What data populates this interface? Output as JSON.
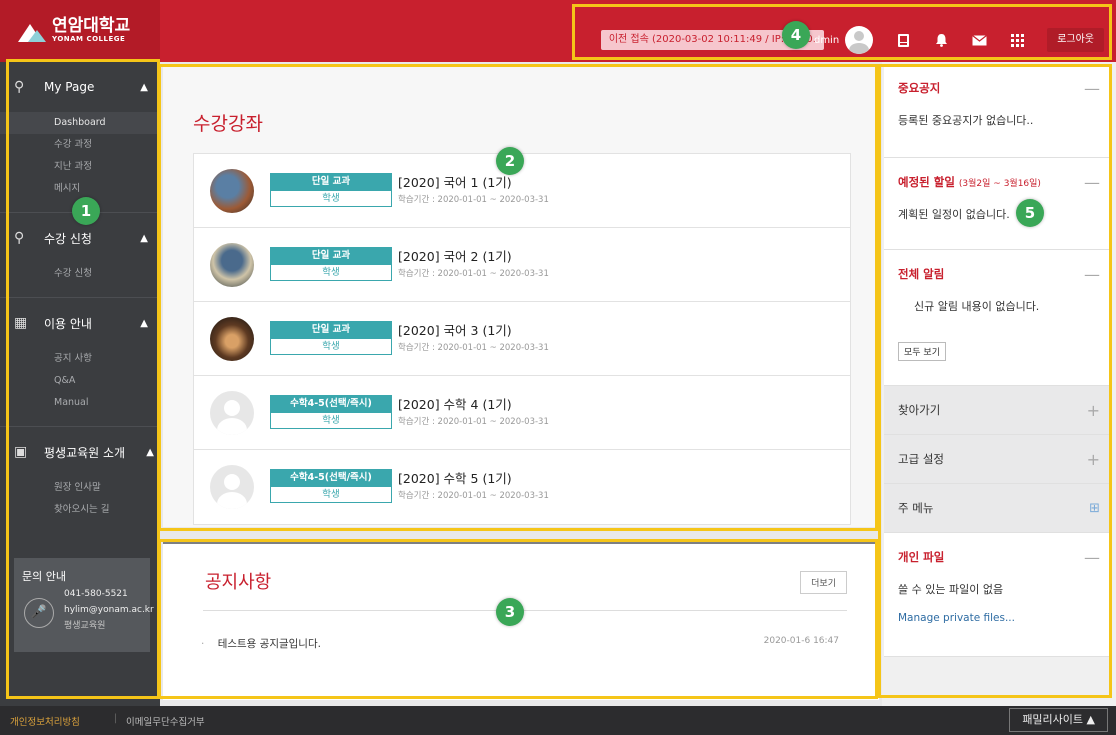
{
  "header": {
    "logo_ko": "연암대학교",
    "logo_en": "YONAM COLLEGE",
    "prev_login": "이전 접속 (2020-03-02 10:11:49 / IP:127.0.",
    "user_name": "dmin",
    "logout": "로그아웃",
    "icons": [
      "tablet-icon",
      "bell-icon",
      "mail-icon",
      "grid-icon"
    ]
  },
  "sidebar": {
    "sections": [
      {
        "title": "My Page",
        "icon": "user-icon",
        "items": [
          "Dashboard",
          "수강 과정",
          "지난 과정",
          "메시지"
        ]
      },
      {
        "title": "수강 신청",
        "icon": "user-icon",
        "items": [
          "수강 신청"
        ]
      },
      {
        "title": "이용 안내",
        "icon": "map-icon",
        "items": [
          "공지 사항",
          "Q&A",
          "Manual"
        ]
      },
      {
        "title": "평생교육원 소개",
        "icon": "book-icon",
        "items": [
          "원장 인사말",
          "찾아오시는 길"
        ]
      }
    ],
    "contact": {
      "title": "문의 안내",
      "phone": "041-580-5521",
      "email": "hylim@yonam.ac.kr",
      "dept": "평생교육원"
    }
  },
  "courses": {
    "title": "수강강좌",
    "items": [
      {
        "type": "단일 교과",
        "role": "학생",
        "name": "[2020] 국어 1 (1기)",
        "period": "학습기간 : 2020-01-01 ~ 2020-03-31"
      },
      {
        "type": "단일 교과",
        "role": "학생",
        "name": "[2020] 국어 2 (1기)",
        "period": "학습기간 : 2020-01-01 ~ 2020-03-31"
      },
      {
        "type": "단일 교과",
        "role": "학생",
        "name": "[2020] 국어 3 (1기)",
        "period": "학습기간 : 2020-01-01 ~ 2020-03-31"
      },
      {
        "type": "수학4-5(선택/즉시)",
        "role": "학생",
        "name": "[2020] 수학 4 (1기)",
        "period": "학습기간 : 2020-01-01 ~ 2020-03-31"
      },
      {
        "type": "수학4-5(선택/즉시)",
        "role": "학생",
        "name": "[2020] 수학 5 (1기)",
        "period": "학습기간 : 2020-01-01 ~ 2020-03-31"
      }
    ]
  },
  "notice": {
    "title": "공지사항",
    "more": "더보기",
    "items": [
      {
        "text": "테스트용 공지글입니다.",
        "date": "2020-01-6 16:47"
      }
    ]
  },
  "right": {
    "important": {
      "title": "중요공지",
      "body": "등록된 중요공지가 없습니다.."
    },
    "schedule": {
      "title": "예정된 할일",
      "range": "(3월2일 ~ 3월16일)",
      "body": "계획된 일정이 없습니다."
    },
    "alerts": {
      "title": "전체 알림",
      "body": "신규 알림 내용이 없습니다.",
      "view_all": "모두 보기"
    },
    "navigation": {
      "title": "찾아가기"
    },
    "settings": {
      "title": "고급 설정"
    },
    "main_menu": {
      "title": "주 메뉴"
    },
    "files": {
      "title": "개인 파일",
      "body": "쓸 수 있는 파일이 없음",
      "link": "Manage private files..."
    }
  },
  "footer": {
    "privacy": "개인정보처리방침",
    "email_refuse": "이메일무단수집거부",
    "family": "패밀리사이트 ▲"
  },
  "annotations": [
    "1",
    "2",
    "3",
    "4",
    "5"
  ],
  "colors": {
    "brand": "#c8202e",
    "teal": "#3aa7ad",
    "highlight": "#f5c518",
    "marker": "#3aa757"
  }
}
